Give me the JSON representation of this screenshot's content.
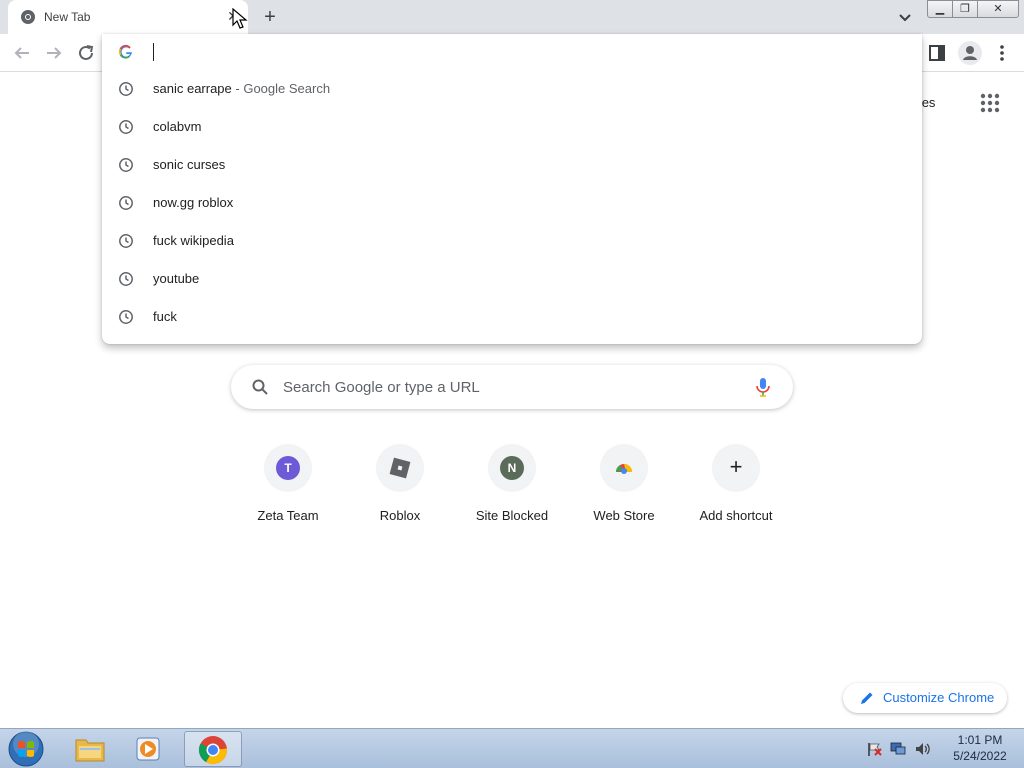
{
  "tab": {
    "title": "New Tab"
  },
  "omnibox": {
    "value": "",
    "suggestions": [
      {
        "text": "sanic earrape",
        "separator": " - ",
        "desc": "Google Search"
      },
      {
        "text": "colabvm"
      },
      {
        "text": "sonic curses"
      },
      {
        "text": "now.gg roblox"
      },
      {
        "text": "fuck wikipedia"
      },
      {
        "text": "youtube"
      },
      {
        "text": "fuck"
      }
    ]
  },
  "header": {
    "images_link": "nages"
  },
  "search": {
    "placeholder": "Search Google or type a URL"
  },
  "shortcuts": [
    {
      "label": "Zeta Team",
      "initial": "T",
      "color": "#6b5bd6"
    },
    {
      "label": "Roblox",
      "initial": "",
      "color": "#5f6368"
    },
    {
      "label": "Site Blocked",
      "initial": "N",
      "color": "#5b6b5a"
    },
    {
      "label": "Web Store",
      "initial": "",
      "color": "#f1f3f4"
    },
    {
      "label": "Add shortcut",
      "initial": "+",
      "color": "#f1f3f4"
    }
  ],
  "customize": {
    "label": "Customize Chrome"
  },
  "taskbar": {
    "time": "1:01 PM",
    "date": "5/24/2022"
  },
  "colors": {
    "accent": "#1a73e8",
    "toolbar_bg": "#dee1e6"
  }
}
